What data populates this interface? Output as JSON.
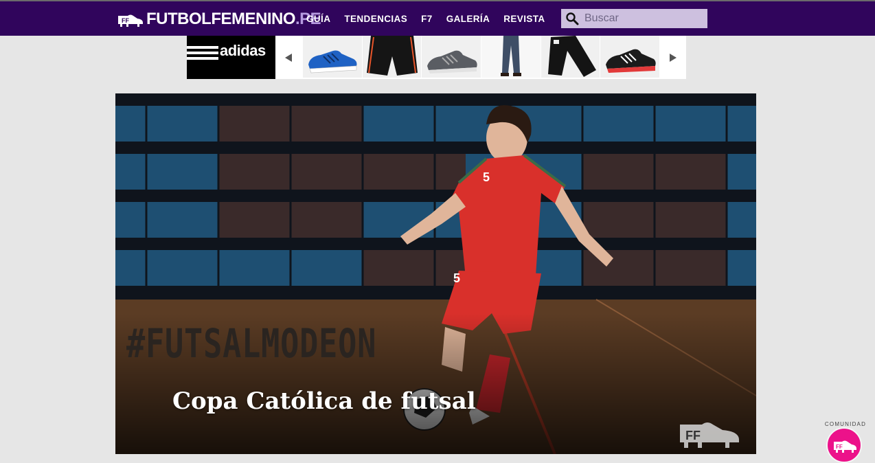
{
  "header": {
    "logo": {
      "name": "FUTBOLFEMENINO",
      "tld": ".PE"
    },
    "nav": [
      "GUÍA",
      "TENDENCIAS",
      "F7",
      "GALERÍA",
      "REVISTA"
    ],
    "search": {
      "placeholder": "Buscar",
      "value": ""
    }
  },
  "carousel": {
    "brand": "adidas",
    "products": [
      {
        "name": "blue sneaker"
      },
      {
        "name": "black shorts"
      },
      {
        "name": "grey running shoe"
      },
      {
        "name": "jeans"
      },
      {
        "name": "black track pants"
      },
      {
        "name": "red black running shoe"
      }
    ]
  },
  "hero": {
    "hashtag": "#FUTSALMODEON",
    "title": "Copa Católica de futsal"
  },
  "community": {
    "label": "COMUNIDAD"
  },
  "colors": {
    "nav_bg": "#30055c",
    "search_bg": "#cdc0df",
    "page_bg": "#e6e6e6",
    "jersey_red": "#d9302b",
    "community_pink": "#ec128a"
  }
}
